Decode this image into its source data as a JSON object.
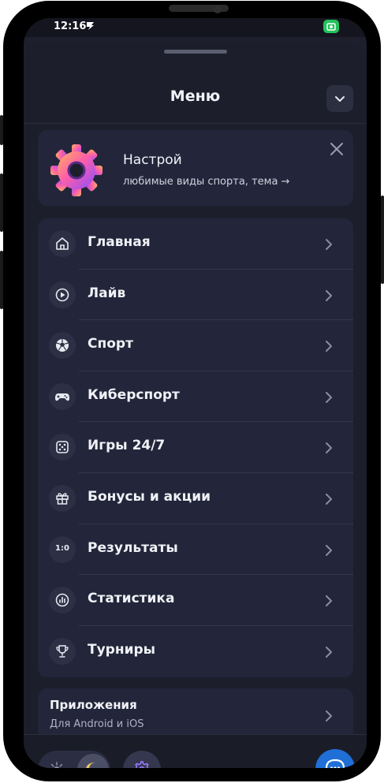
{
  "status_bar": {
    "time": "12:16"
  },
  "header": {
    "title": "Меню"
  },
  "promo": {
    "title": "Настрой",
    "subtitle": "любимые виды спорта, тема →"
  },
  "menu": {
    "items": [
      {
        "label": "Главная",
        "icon": "home-icon"
      },
      {
        "label": "Лайв",
        "icon": "play-icon"
      },
      {
        "label": "Спорт",
        "icon": "soccer-ball-icon"
      },
      {
        "label": "Киберспорт",
        "icon": "gamepad-icon"
      },
      {
        "label": "Игры 24/7",
        "icon": "dice-icon"
      },
      {
        "label": "Бонусы и акции",
        "icon": "gift-icon"
      },
      {
        "label": "Результаты",
        "icon": "score-icon",
        "icon_text": "1:0"
      },
      {
        "label": "Статистика",
        "icon": "stats-icon"
      },
      {
        "label": "Турниры",
        "icon": "trophy-icon"
      }
    ]
  },
  "apps": {
    "title": "Приложения",
    "subtitle": "Для Android и iOS"
  },
  "colors": {
    "background": "#1c1e2c",
    "card": "#23263a",
    "accent_blue": "#1f6fd6",
    "accent_purple": "#9b7bff",
    "status_green": "#22c25b"
  }
}
